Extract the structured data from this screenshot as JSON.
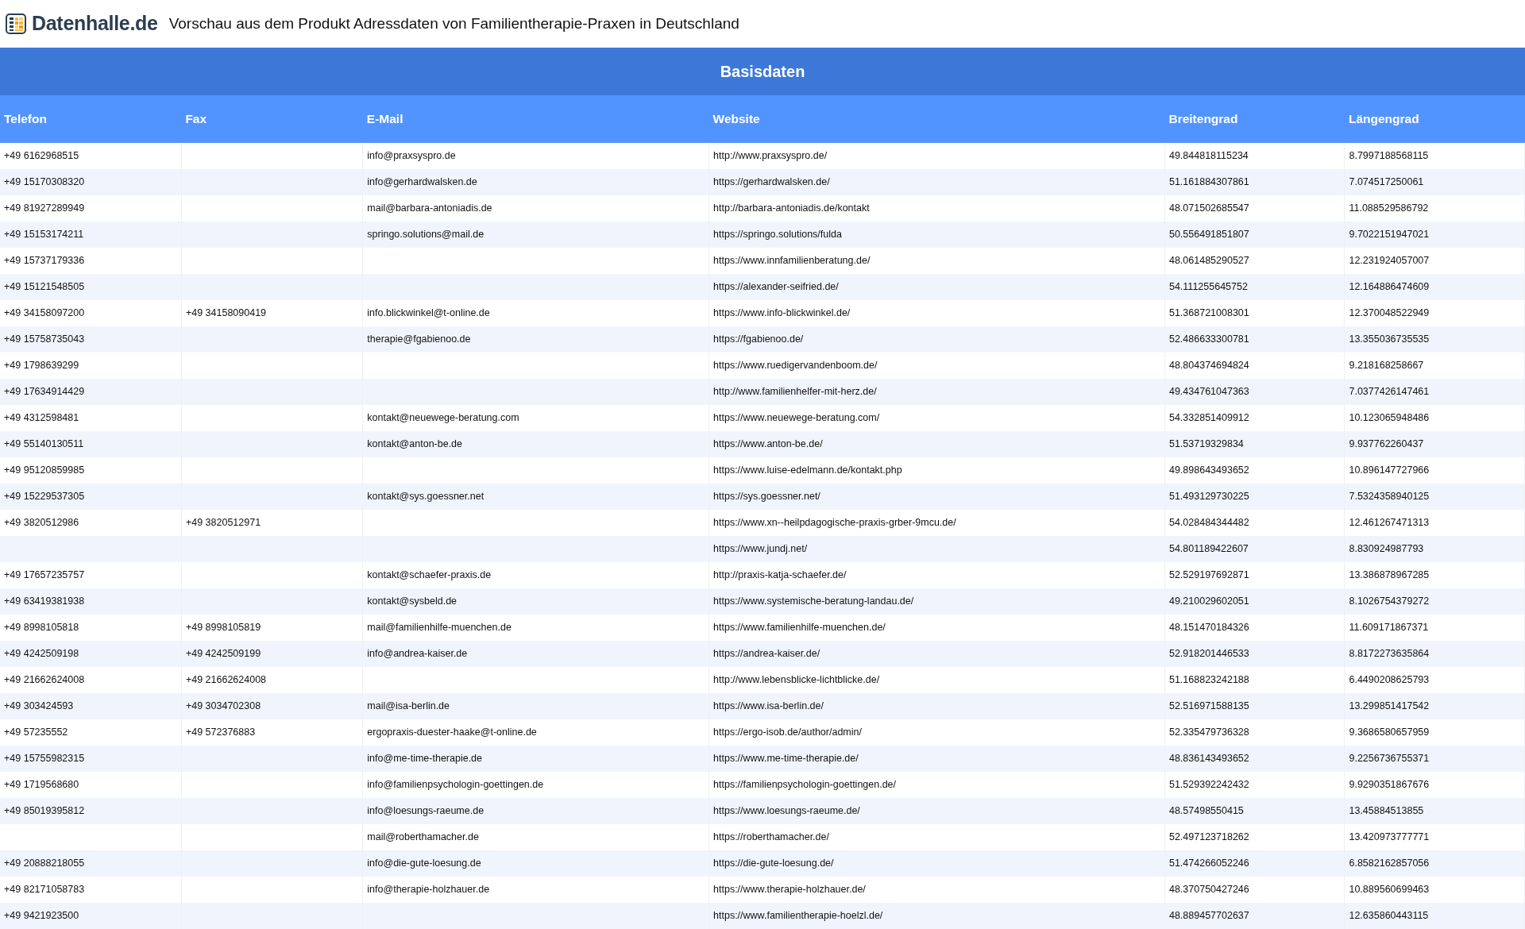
{
  "header": {
    "logo_text": "Datenhalle.de",
    "title": "Vorschau aus dem Produkt Adressdaten von Familientherapie-Praxen in Deutschland"
  },
  "table": {
    "group_heading": "Basisdaten",
    "columns": [
      "Telefon",
      "Fax",
      "E-Mail",
      "Website",
      "Breitengrad",
      "Längengrad"
    ],
    "rows": [
      [
        "+49 6162968515",
        null,
        "info@praxsyspro.de",
        "http://www.praxsyspro.de/",
        "49.844818115234",
        "8.7997188568115"
      ],
      [
        "+49 15170308320",
        null,
        "info@gerhardwalsken.de",
        "https://gerhardwalsken.de/",
        "51.161884307861",
        "7.074517250061"
      ],
      [
        "+49 81927289949",
        null,
        "mail@barbara-antoniadis.de",
        "http://barbara-antoniadis.de/kontakt",
        "48.071502685547",
        "11.088529586792"
      ],
      [
        "+49 15153174211",
        null,
        "springo.solutions@mail.de",
        "https://springo.solutions/fulda",
        "50.556491851807",
        "9.7022151947021"
      ],
      [
        "+49 15737179336",
        null,
        null,
        "https://www.innfamilienberatung.de/",
        "48.061485290527",
        "12.231924057007"
      ],
      [
        "+49 15121548505",
        null,
        null,
        "https://alexander-seifried.de/",
        "54.111255645752",
        "12.164886474609"
      ],
      [
        "+49 34158097200",
        "+49 34158090419",
        "info.blickwinkel@t-online.de",
        "https://www.info-blickwinkel.de/",
        "51.368721008301",
        "12.370048522949"
      ],
      [
        "+49 15758735043",
        null,
        "therapie@fgabienoo.de",
        "https://fgabienoo.de/",
        "52.486633300781",
        "13.355036735535"
      ],
      [
        "+49 1798639299",
        null,
        null,
        "https://www.ruedigervandenboom.de/",
        "48.804374694824",
        "9.218168258667"
      ],
      [
        "+49 17634914429",
        null,
        null,
        "http://www.familienhelfer-mit-herz.de/",
        "49.434761047363",
        "7.0377426147461"
      ],
      [
        "+49 4312598481",
        null,
        "kontakt@neuewege-beratung.com",
        "https://www.neuewege-beratung.com/",
        "54.332851409912",
        "10.123065948486"
      ],
      [
        "+49 55140130511",
        null,
        "kontakt@anton-be.de",
        "https://www.anton-be.de/",
        "51.53719329834",
        "9.937762260437"
      ],
      [
        "+49 95120859985",
        null,
        null,
        "https://www.luise-edelmann.de/kontakt.php",
        "49.898643493652",
        "10.896147727966"
      ],
      [
        "+49 15229537305",
        null,
        "kontakt@sys.goessner.net",
        "https://sys.goessner.net/",
        "51.493129730225",
        "7.5324358940125"
      ],
      [
        "+49 3820512986",
        "+49 3820512971",
        null,
        "https://www.xn--heilpdagogische-praxis-grber-9mcu.de/",
        "54.028484344482",
        "12.461267471313"
      ],
      [
        null,
        null,
        null,
        "https://www.jundj.net/",
        "54.801189422607",
        "8.830924987793"
      ],
      [
        "+49 17657235757",
        null,
        "kontakt@schaefer-praxis.de",
        "http://praxis-katja-schaefer.de/",
        "52.529197692871",
        "13.386878967285"
      ],
      [
        "+49 63419381938",
        null,
        "kontakt@sysbeld.de",
        "https://www.systemische-beratung-landau.de/",
        "49.210029602051",
        "8.1026754379272"
      ],
      [
        "+49 8998105818",
        "+49 8998105819",
        "mail@familienhilfe-muenchen.de",
        "https://www.familienhilfe-muenchen.de/",
        "48.151470184326",
        "11.609171867371"
      ],
      [
        "+49 4242509198",
        "+49 4242509199",
        "info@andrea-kaiser.de",
        "https://andrea-kaiser.de/",
        "52.918201446533",
        "8.8172273635864"
      ],
      [
        "+49 21662624008",
        "+49 21662624008",
        null,
        "http://www.lebensblicke-lichtblicke.de/",
        "51.168823242188",
        "6.4490208625793"
      ],
      [
        "+49 303424593",
        "+49 3034702308",
        "mail@isa-berlin.de",
        "https://www.isa-berlin.de/",
        "52.516971588135",
        "13.299851417542"
      ],
      [
        "+49 57235552",
        "+49 572376883",
        "ergopraxis-duester-haake@t-online.de",
        "https://ergo-isob.de/author/admin/",
        "52.335479736328",
        "9.3686580657959"
      ],
      [
        "+49 15755982315",
        null,
        "info@me-time-therapie.de",
        "https://www.me-time-therapie.de/",
        "48.836143493652",
        "9.2256736755371"
      ],
      [
        "+49 1719568680",
        null,
        "info@familienpsychologin-goettingen.de",
        "https://familienpsychologin-goettingen.de/",
        "51.529392242432",
        "9.9290351867676"
      ],
      [
        "+49 85019395812",
        null,
        "info@loesungs-raeume.de",
        "https://www.loesungs-raeume.de/",
        "48.57498550415",
        "13.45884513855"
      ],
      [
        null,
        null,
        "mail@roberthamacher.de",
        "https://roberthamacher.de/",
        "52.497123718262",
        "13.420973777771"
      ],
      [
        "+49 20888218055",
        null,
        "info@die-gute-loesung.de",
        "https://die-gute-loesung.de/",
        "51.474266052246",
        "6.8582162857056"
      ],
      [
        "+49 82171058783",
        null,
        "info@therapie-holzhauer.de",
        "https://www.therapie-holzhauer.de/",
        "48.370750427246",
        "10.889560699463"
      ],
      [
        "+49 9421923500",
        null,
        null,
        "https://www.familientherapie-hoelzl.de/",
        "48.889457702637",
        "12.635860443115"
      ]
    ]
  }
}
